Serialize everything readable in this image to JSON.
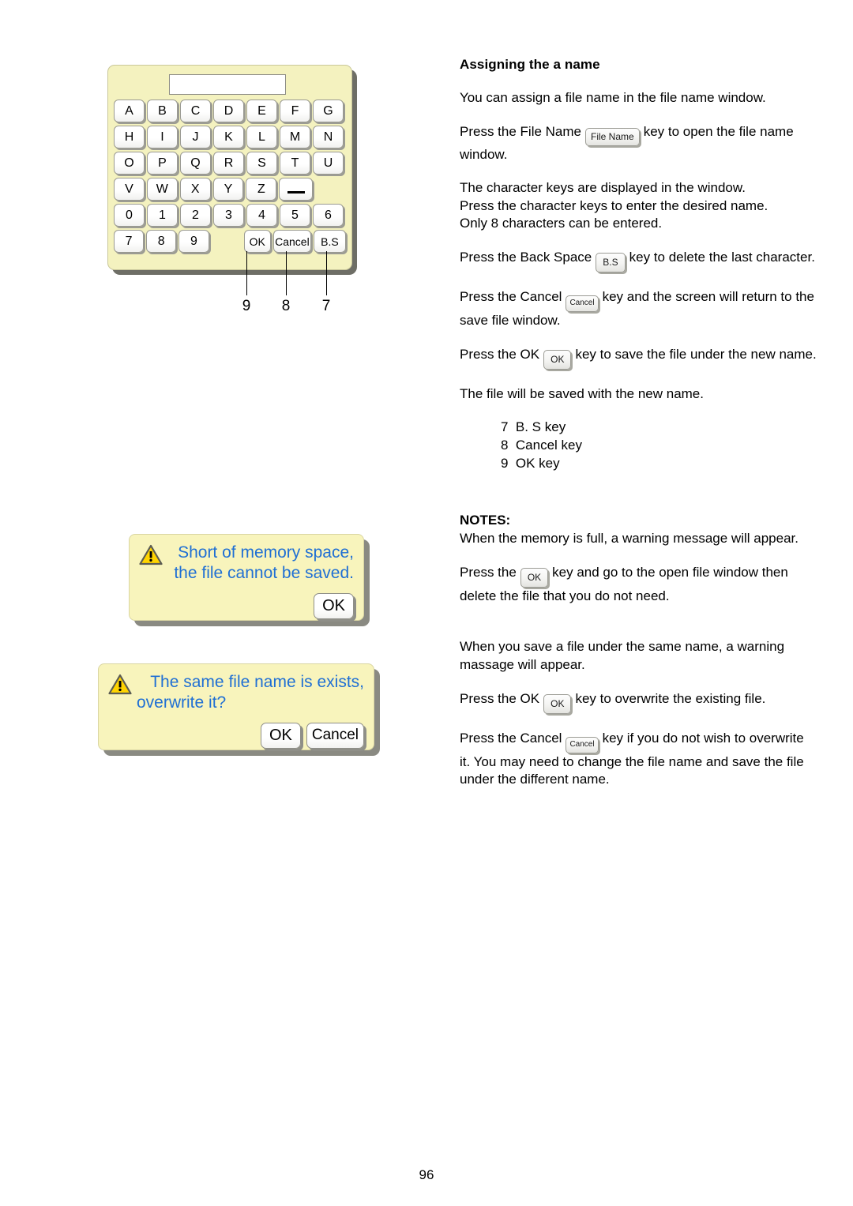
{
  "page": {
    "number": "96"
  },
  "keyboard": {
    "display_value": "",
    "rows": [
      [
        "A",
        "B",
        "C",
        "D",
        "E",
        "F",
        "G"
      ],
      [
        "H",
        "I",
        "J",
        "K",
        "L",
        "M",
        "N"
      ],
      [
        "O",
        "P",
        "Q",
        "R",
        "S",
        "T",
        "U"
      ],
      [
        "V",
        "W",
        "X",
        "Y",
        "Z",
        "_",
        ""
      ],
      [
        "0",
        "1",
        "2",
        "3",
        "4",
        "5",
        "6"
      ],
      [
        "7",
        "8",
        "9",
        "",
        "OK",
        "Cancel",
        "B.S"
      ]
    ],
    "callouts": [
      {
        "number": "9",
        "target": "OK"
      },
      {
        "number": "8",
        "target": "Cancel"
      },
      {
        "number": "7",
        "target": "B.S"
      }
    ]
  },
  "dialogs": [
    {
      "name": "memory-warning",
      "icon": "warning-triangle-icon",
      "message_line1": "Short of memory space,",
      "message_line2": "the file cannot be saved.",
      "buttons": [
        "OK"
      ]
    },
    {
      "name": "overwrite-confirm",
      "icon": "warning-triangle-icon",
      "message_line1": "The same file name is exists,",
      "message_line2": "overwrite it?",
      "buttons": [
        "OK",
        "Cancel"
      ]
    }
  ],
  "article": {
    "heading": "Assigning the a name",
    "p1": "You can assign a file name in the file name window.",
    "p2_pre": "Press the File Name",
    "p2_key": "File Name",
    "p2_post": "key to open the file name window.",
    "p3_line1": "The character keys are displayed in the window.",
    "p3_line2": "Press the character keys to enter the desired name.",
    "p3_line3": "Only 8 characters can be entered.",
    "p4_pre": "Press the Back Space",
    "p4_key": "B.S",
    "p4_post": "key to delete the last character.",
    "p5_pre": "Press the Cancel",
    "p5_key": "Cancel",
    "p5_post": "key and the screen will return to the save file window.",
    "p6_pre": "Press the OK",
    "p6_key": "OK",
    "p6_post": "key to save the file under the new name.",
    "p7": "The file will be saved with the new name.",
    "legend": [
      "7  B. S key",
      "8  Cancel key",
      "9  OK key"
    ]
  },
  "notes": {
    "heading": "NOTES:",
    "n1": "When the memory is full, a warning message will appear.",
    "n2_pre": "Press the",
    "n2_key": "OK",
    "n2_post": "key and go to the open file window then delete the file that you do not need.",
    "n3": "When you save a file under the same name, a warning massage will appear.",
    "n4_pre": "Press the OK",
    "n4_key": "OK",
    "n4_post": "key to overwrite the existing file.",
    "n5_pre": "Press the Cancel",
    "n5_key": "Cancel",
    "n5_post": "key if you do not wish to overwrite it. You may need to change the file name and save the file under the different name."
  },
  "colors": {
    "panel_yellow": "#f4f2bf",
    "dialog_yellow": "#f8f4bc",
    "dialog_text_blue": "#1f6fd4",
    "warning_yellow": "#ffd700",
    "shadow_gray": "#8a8a82"
  }
}
